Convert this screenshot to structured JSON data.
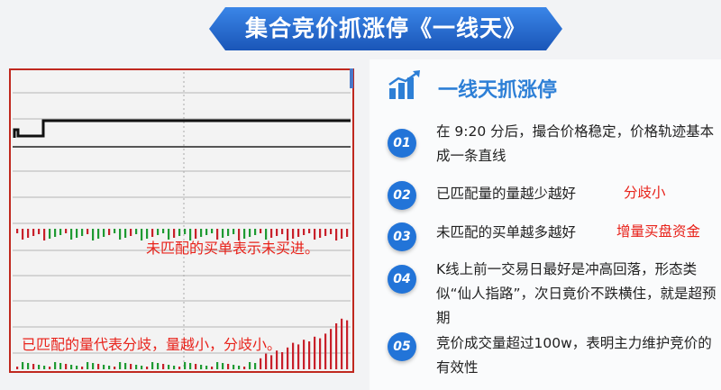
{
  "title": "集合竞价抓涨停《一线天》",
  "heading": "一线天抓涨停",
  "items": [
    {
      "num": "01",
      "text": "在 9:20 分后，撮合价格稳定，价格轨迹基本成一条直线"
    },
    {
      "num": "02",
      "text": "已匹配量的量越少越好",
      "note": "分歧小"
    },
    {
      "num": "03",
      "text": "未匹配的买单越多越好",
      "note": "增量买盘资金"
    },
    {
      "num": "04",
      "text": "K线上前一交易日最好是冲高回落，形态类似“仙人指路”，次日竟价不跌横住，就是超预期"
    },
    {
      "num": "05",
      "text": "竞价成交量超过100w，表明主力维护竞价的有效性"
    }
  ],
  "chart_notes": {
    "unmatched": "未匹配的买单表示未买进。",
    "matched": "已匹配的量代表分歧，量越小，分歧小。"
  },
  "colors": {
    "banner": "#1f64c9",
    "accent": "#2d7fd6",
    "badge": "#2274d8",
    "annotation": "#e8221a",
    "chart_border": "#c0281f",
    "bar_red": "#c8202a",
    "bar_green": "#1e9a32"
  },
  "icons": {
    "heading": "bar-chart-growth-icon"
  }
}
